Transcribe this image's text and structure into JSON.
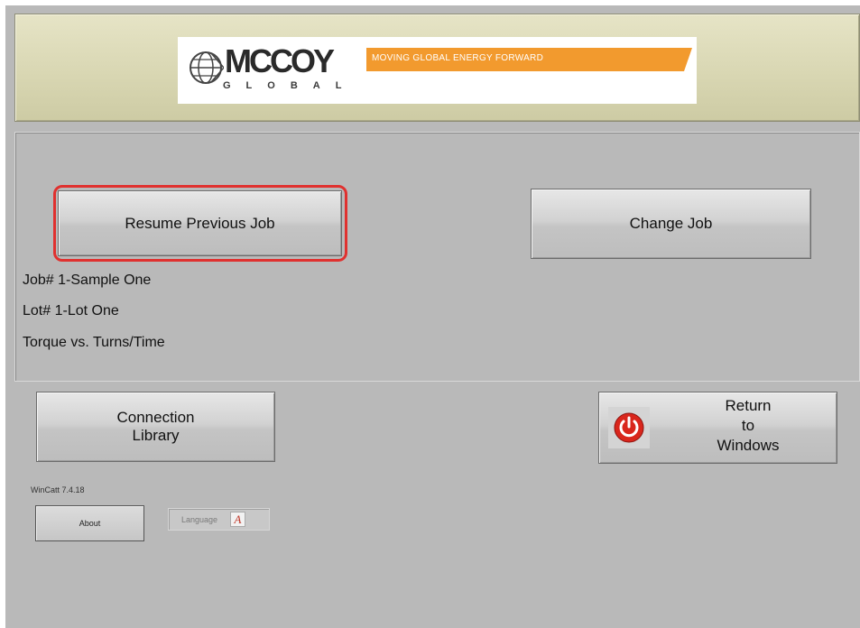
{
  "header": {
    "logo_text": "MCCOY",
    "logo_sub": "GLOBAL",
    "logo_tagline": "MOVING GLOBAL ENERGY FORWARD"
  },
  "job_panel": {
    "resume_button": "Resume Previous Job",
    "change_button": "Change Job",
    "job_line": "Job# 1-Sample One",
    "lot_line": "Lot# 1-Lot One",
    "mode_line": "Torque vs. Turns/Time"
  },
  "actions": {
    "connection_library_line1": "Connection",
    "connection_library_line2": "Library",
    "return_line1": "Return",
    "return_line2": "to",
    "return_line3": "Windows"
  },
  "footer": {
    "version": "WinCatt 7.4.18",
    "about_button": "About",
    "language_button": "Language"
  },
  "icons": {
    "power": "power-icon",
    "language": "language-icon",
    "globe": "globe-logo-icon"
  },
  "colors": {
    "header_bg": "#d9d7b3",
    "window_bg": "#b9b9b9",
    "highlight": "#e0312f",
    "accent_orange": "#f29a2e",
    "power_red": "#d9261c"
  }
}
